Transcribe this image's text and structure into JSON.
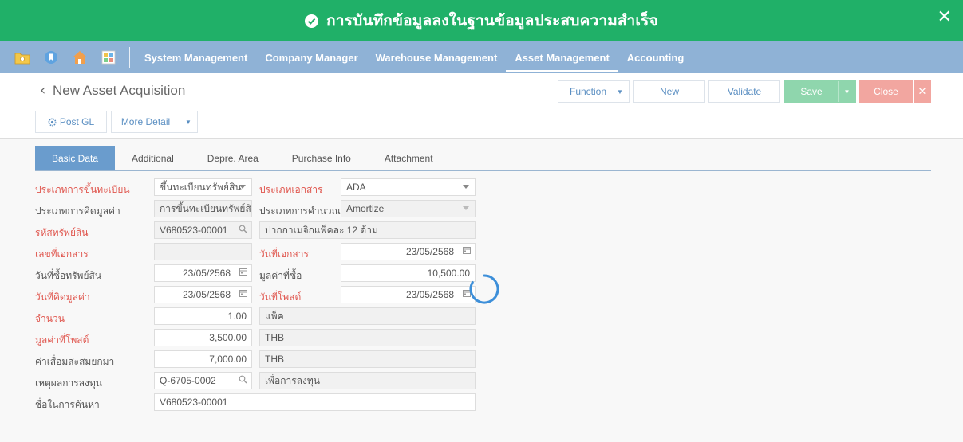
{
  "banner": {
    "message": "การบันทึกข้อมูลลงในฐานข้อมูลประสบความสำเร็จ",
    "close": "✕"
  },
  "nav": {
    "menu": [
      "System Management",
      "Company Manager",
      "Warehouse Management",
      "Asset Management",
      "Accounting"
    ],
    "active": "Asset Management"
  },
  "page": {
    "back": "‹",
    "title": "New Asset Acquisition",
    "buttons": {
      "function": "Function",
      "new": "New",
      "validate": "Validate",
      "save": "Save",
      "close": "Close",
      "close_x": "✕",
      "post_gl": "Post GL",
      "more_detail": "More Detail"
    }
  },
  "tabs": [
    "Basic Data",
    "Additional",
    "Depre. Area",
    "Purchase Info",
    "Attachment"
  ],
  "form": {
    "registration_type": {
      "label": "ประเภทการขึ้นทะเบียน",
      "value": "ขึ้นทะเบียนทรัพย์สิน"
    },
    "document_type": {
      "label": "ประเภทเอกสาร",
      "value": "ADA"
    },
    "valuation_type": {
      "label": "ประเภทการคิดมูลค่า",
      "value": "การขึ้นทะเบียนทรัพย์สิน"
    },
    "calculation_type": {
      "label": "ประเภทการคำนวณ",
      "value": "Amortize"
    },
    "asset_code": {
      "label": "รหัสทรัพย์สิน",
      "value": "V680523-00001",
      "description": "ปากกาเมจิกแพ็คละ 12 ด้าม"
    },
    "document_no": {
      "label": "เลขที่เอกสาร",
      "value": ""
    },
    "document_date": {
      "label": "วันที่เอกสาร",
      "value": "23/05/2568"
    },
    "asset_purchase_date": {
      "label": "วันที่ซื้อทรัพย์สิน",
      "value": "23/05/2568"
    },
    "purchase_value": {
      "label": "มูลค่าที่ซื้อ",
      "value": "10,500.00"
    },
    "valuation_date": {
      "label": "วันที่คิดมูลค่า",
      "value": "23/05/2568"
    },
    "posting_date": {
      "label": "วันที่โพสต์",
      "value": "23/05/2568"
    },
    "quantity": {
      "label": "จำนวน",
      "value": "1.00",
      "unit": "แพ็ค"
    },
    "posted_value": {
      "label": "มูลค่าที่โพสต์",
      "value": "3,500.00",
      "currency": "THB"
    },
    "accumulated_depreciation": {
      "label": "ค่าเสื่อมสะสมยกมา",
      "value": "7,000.00",
      "currency": "THB"
    },
    "investment_reason": {
      "label": "เหตุผลการลงทุน",
      "value": "Q-6705-0002",
      "description": "เพื่อการลงทุน"
    },
    "search_name": {
      "label": "ชื่อในการค้นหา",
      "value": "V680523-00001"
    }
  },
  "colors": {
    "banner": "#20b068",
    "navbar": "#8fb2d6",
    "active_tab": "#6a9ccd",
    "required_label": "#e0574f",
    "save": "#8fd6ad",
    "close": "#f2a6a0"
  }
}
